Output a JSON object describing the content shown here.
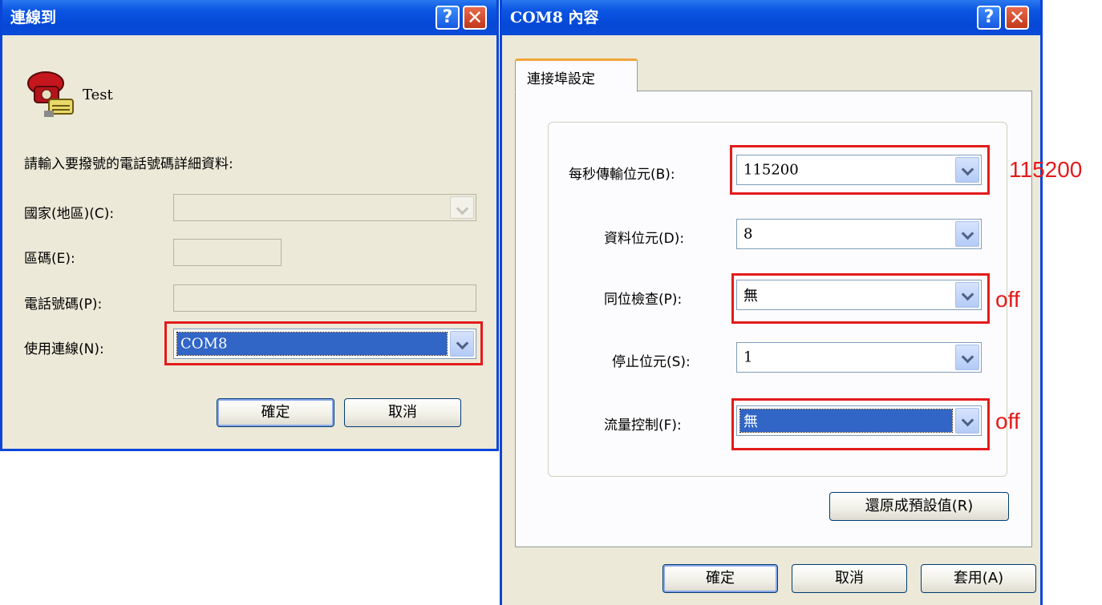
{
  "connect_dialog": {
    "title": "連線到",
    "connection_name": "Test",
    "prompt": "請輸入要撥號的電話號碼詳細資料:",
    "country_label": "國家(地區)(C):",
    "area_code_label": "區碼(E):",
    "phone_label": "電話號碼(P):",
    "connect_using_label": "使用連線(N):",
    "connect_using_value": "COM8",
    "ok_label": "確定",
    "cancel_label": "取消"
  },
  "props_dialog": {
    "title": "COM8 內容",
    "tab_label": "連接埠設定",
    "baud_label": "每秒傳輸位元(B):",
    "baud_value": "115200",
    "data_bits_label": "資料位元(D):",
    "data_bits_value": "8",
    "parity_label": "同位檢查(P):",
    "parity_value": "無",
    "stop_bits_label": "停止位元(S):",
    "stop_bits_value": "1",
    "flow_label": "流量控制(F):",
    "flow_value": "無",
    "restore_label": "還原成預設值(R)",
    "ok_label": "確定",
    "cancel_label": "取消",
    "apply_label": "套用(A)"
  },
  "titlebar_buttons": {
    "help": "?",
    "close": "✕"
  },
  "annotations": {
    "baud_note": "115200",
    "parity_note": "off",
    "flow_note": "off"
  },
  "colors": {
    "highlight": "#e31b1b",
    "titlebar": "#0648d6",
    "selection": "#3165c6"
  }
}
